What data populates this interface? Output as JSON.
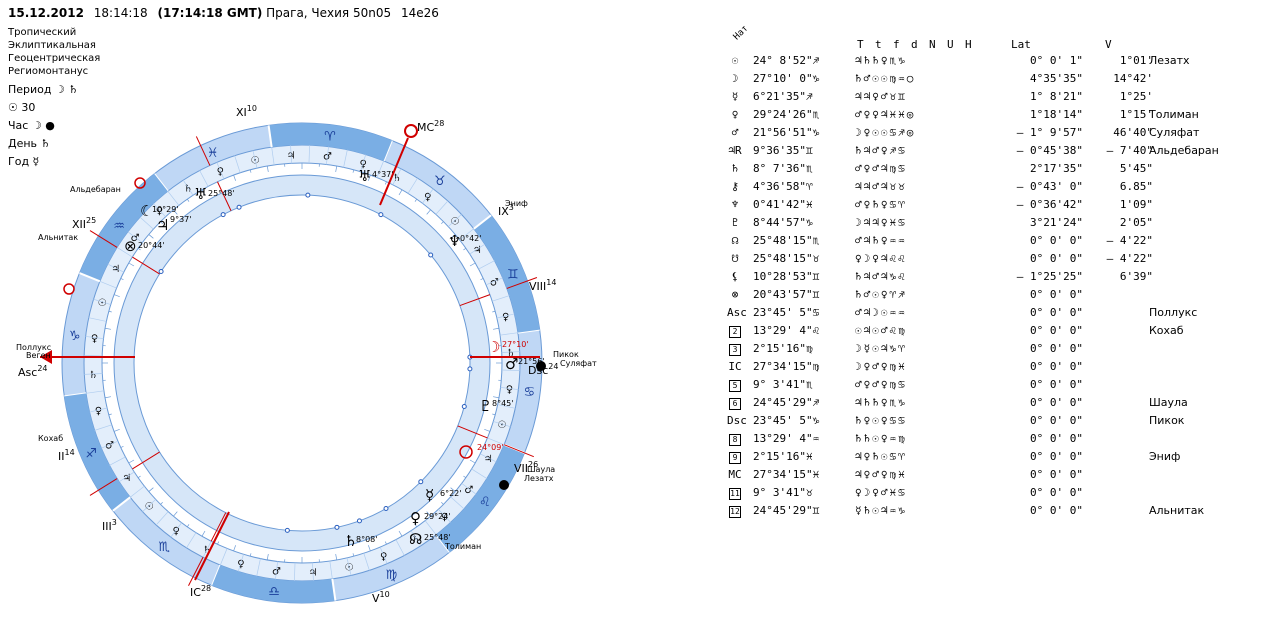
{
  "header": {
    "date": "15.12.2012",
    "time": "18:14:18",
    "gmt": "(17:14:18 GMT)",
    "place": "Прага, Чехия 50n05",
    "lon": "14e26"
  },
  "system_lines": [
    "Тропический",
    "Эклиптикальная",
    "Геоцентрическая",
    "Региомонтанус"
  ],
  "rulers": [
    {
      "label": "Период",
      "value": "☽ ♄"
    },
    {
      "label": "",
      "value": "☉ 30"
    },
    {
      "label": "Час",
      "value": "☽ ●"
    },
    {
      "label": "День",
      "value": "♄"
    },
    {
      "label": "Год",
      "value": "☿"
    }
  ],
  "wheel": {
    "house_labels": [
      {
        "text": "XI",
        "sup": "10"
      },
      {
        "text": "MC",
        "sup": "28"
      },
      {
        "text": "IX",
        "sup": "3"
      },
      {
        "text": "VIII",
        "sup": "14"
      },
      {
        "text": "Dsc",
        "sup": "24"
      },
      {
        "text": "VII",
        "sup": "26"
      },
      {
        "text": "V",
        "sup": "10"
      },
      {
        "text": "IC",
        "sup": "28"
      },
      {
        "text": "III",
        "sup": "3"
      },
      {
        "text": "II",
        "sup": "14"
      },
      {
        "text": "Asc",
        "sup": "24"
      },
      {
        "text": "XII",
        "sup": "25"
      }
    ],
    "signs": [
      "♈",
      "♓",
      "♒",
      "♑",
      "♐",
      "♏",
      "♎",
      "♍",
      "♌",
      "♋",
      "♊",
      "♉"
    ],
    "stars": [
      "Альдебаран",
      "Альнитак",
      "Поллукс",
      "Веген",
      "Кохаб",
      "Эниф",
      "Пикок",
      "Суляфат",
      "Шаула",
      "Лезатх",
      "Толиман"
    ],
    "planet_degrees": [
      "10°29'",
      "9°37'",
      "25°48'",
      "20°44'",
      "4°37'",
      "0°42'",
      "27°10'",
      "21°56'",
      "8°45'",
      "24°09'",
      "6°22'",
      "29°24'",
      "25°48'",
      "8°08'"
    ]
  },
  "table": {
    "col_headers": [
      "Нат",
      "T",
      "t",
      "f",
      "d",
      "N",
      "U",
      "H",
      "Lat",
      "V"
    ],
    "rows": [
      {
        "sym": "☉",
        "pos": "24° 8'52\"♐",
        "asp": "♃♄♄♀♏♑",
        "lat": "0° 0' 1\"",
        "v": "1°01'",
        "star": "Лезатх"
      },
      {
        "sym": "☽",
        "pos": "27°10' 0\"♑",
        "asp": "♄♂☉☉♍♒○",
        "lat": "4°35'35\"",
        "v": "14°42'",
        "star": ""
      },
      {
        "sym": "☿",
        "pos": "6°21'35\"♐",
        "asp": "♃♃♀♂♉♊",
        "lat": "1° 8'21\"",
        "v": "1°25'",
        "star": ""
      },
      {
        "sym": "♀",
        "pos": "29°24'26\"♏",
        "asp": "♂♀♀♃♓♓◎",
        "lat": "1°18'14\"",
        "v": "1°15'",
        "star": "Толиман"
      },
      {
        "sym": "♂",
        "pos": "21°56'51\"♑",
        "asp": "☽♀☉☉♋♐◎",
        "lat": "– 1° 9'57\"",
        "v": "46'40\"",
        "star": "Суляфат"
      },
      {
        "sym": "♃R",
        "pos": "9°36'35\"♊",
        "asp": "♄♃♂♀♐♋",
        "lat": "– 0°45'38\"",
        "v": "– 7'40\"",
        "star": "Альдебаран"
      },
      {
        "sym": "♄",
        "pos": "8° 7'36\"♏",
        "asp": "♂♀♂♃♍♋",
        "lat": "2°17'35\"",
        "v": "5'45\"",
        "star": ""
      },
      {
        "sym": "⚷",
        "pos": "4°36'58\"♈",
        "asp": "♃♃♂♃♉♉",
        "lat": "– 0°43' 0\"",
        "v": "6.85\"",
        "star": ""
      },
      {
        "sym": "♆",
        "pos": "0°41'42\"♓",
        "asp": "♂♀♄♀♋♈",
        "lat": "– 0°36'42\"",
        "v": "1'09\"",
        "star": ""
      },
      {
        "sym": "♇",
        "pos": "8°44'57\"♑",
        "asp": "☽♃♃♀♓♋",
        "lat": "3°21'24\"",
        "v": "2'05\"",
        "star": ""
      },
      {
        "sym": "☊",
        "pos": "25°48'15\"♏",
        "asp": "♂♃♄♀♒♒",
        "lat": "0° 0' 0\"",
        "v": "– 4'22\"",
        "star": ""
      },
      {
        "sym": "☋",
        "pos": "25°48'15\"♉",
        "asp": "♀☽♀♃♌♌",
        "lat": "0° 0' 0\"",
        "v": "– 4'22\"",
        "star": ""
      },
      {
        "sym": "⚸",
        "pos": "10°28'53\"♊",
        "asp": "♄♃♂♃♑♌",
        "lat": "– 1°25'25\"",
        "v": "6'39\"",
        "star": ""
      },
      {
        "sym": "⊗",
        "pos": "20°43'57\"♊",
        "asp": "♄♂☉♀♈♐",
        "lat": "0° 0' 0\"",
        "v": "",
        "star": ""
      },
      {
        "sym": "Asc",
        "pos": "23°45' 5\"♋",
        "asp": "♂♃☽☉♒♒",
        "lat": "0° 0' 0\"",
        "v": "",
        "star": "Поллукс"
      },
      {
        "sym": "2",
        "pos": "13°29' 4\"♌",
        "asp": "☉♃☉♂♌♍",
        "lat": "0° 0' 0\"",
        "v": "",
        "star": "Кохаб"
      },
      {
        "sym": "3",
        "pos": "2°15'16\"♍",
        "asp": "☽☿☉♃♑♈",
        "lat": "0° 0' 0\"",
        "v": "",
        "star": ""
      },
      {
        "sym": "IC",
        "pos": "27°34'15\"♍",
        "asp": "☽♀♂♀♍♓",
        "lat": "0° 0' 0\"",
        "v": "",
        "star": ""
      },
      {
        "sym": "5",
        "pos": "9° 3'41\"♏",
        "asp": "♂♀♂♀♍♋",
        "lat": "0° 0' 0\"",
        "v": "",
        "star": ""
      },
      {
        "sym": "6",
        "pos": "24°45'29\"♐",
        "asp": "♃♄♄♀♏♑",
        "lat": "0° 0' 0\"",
        "v": "",
        "star": "Шаула"
      },
      {
        "sym": "Dsc",
        "pos": "23°45' 5\"♑",
        "asp": "♄♀☉♀♋♋",
        "lat": "0° 0' 0\"",
        "v": "",
        "star": "Пикок"
      },
      {
        "sym": "8",
        "pos": "13°29' 4\"♒",
        "asp": "♄♄☉♀♒♍",
        "lat": "0° 0' 0\"",
        "v": "",
        "star": ""
      },
      {
        "sym": "9",
        "pos": "2°15'16\"♓",
        "asp": "♃♀♄☉♋♈",
        "lat": "0° 0' 0\"",
        "v": "",
        "star": "Эниф"
      },
      {
        "sym": "MC",
        "pos": "27°34'15\"♓",
        "asp": "♃♀♂♀♍♓",
        "lat": "0° 0' 0\"",
        "v": "",
        "star": ""
      },
      {
        "sym": "11",
        "pos": "9° 3'41\"♉",
        "asp": "♀☽♀♂♓♋",
        "lat": "0° 0' 0\"",
        "v": "",
        "star": ""
      },
      {
        "sym": "12",
        "pos": "24°45'29\"♊",
        "asp": "☿♄☉♃♒♑",
        "lat": "0° 0' 0\"",
        "v": "",
        "star": "Альнитак"
      }
    ]
  }
}
